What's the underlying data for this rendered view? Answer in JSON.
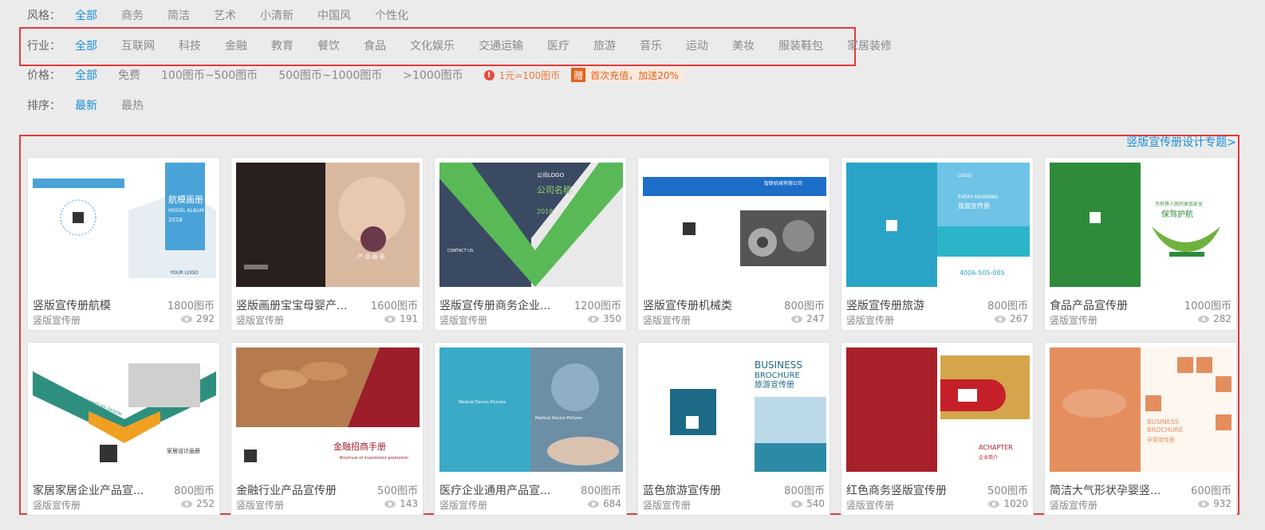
{
  "filters": {
    "style": {
      "label": "风格：",
      "options": [
        "全部",
        "商务",
        "简洁",
        "艺术",
        "小清新",
        "中国风",
        "个性化"
      ],
      "active": 0
    },
    "industry": {
      "label": "行业：",
      "options": [
        "全部",
        "互联网",
        "科技",
        "金融",
        "教育",
        "餐饮",
        "食品",
        "文化娱乐",
        "交通运输",
        "医疗",
        "旅游",
        "音乐",
        "运动",
        "美妆",
        "服装鞋包",
        "家居装修"
      ],
      "active": 0
    },
    "price": {
      "label": "价格：",
      "options": [
        "全部",
        "免费",
        "100图币~500图币",
        "500图币~1000图币",
        ">1000图币"
      ],
      "active": 0,
      "rate_note": "1元=100图币",
      "gift_icon": "赠",
      "gift_note": "首次充值，加送20%"
    },
    "sort": {
      "label": "排序：",
      "options": [
        "最新",
        "最热"
      ],
      "active": 0
    }
  },
  "topic_link": "竖版宣传册设计专题>",
  "colors": {
    "accent": "#1a8fd8",
    "highlight": "#e33a3a",
    "warning": "#f07a3a"
  },
  "cards": [
    {
      "title": "竖版宣传册航模",
      "price": "1800图币",
      "category": "竖版宣传册",
      "views": "292",
      "thumb": {
        "t1": "航模画册",
        "t2": "MODEL ALBUM",
        "t3": "2018",
        "t4": "YOUR LOGO"
      }
    },
    {
      "title": "竖版画册宝宝母婴产...",
      "price": "1600图币",
      "category": "竖版宣传册",
      "views": "191",
      "thumb": {
        "t1": "产 品 画 册"
      }
    },
    {
      "title": "竖版宣传册商务企业...",
      "price": "1200图币",
      "category": "竖版宣传册",
      "views": "350",
      "thumb": {
        "t1": "公司LOGO",
        "t2": "公司名称",
        "t3": "2018",
        "t4": "CONTACT US"
      }
    },
    {
      "title": "竖版宣传册机械类",
      "price": "800图币",
      "category": "竖版宣传册",
      "views": "247",
      "thumb": {
        "t1": "智联机械有限公司"
      }
    },
    {
      "title": "竖版宣传册旅游",
      "price": "800图币",
      "category": "竖版宣传册",
      "views": "267",
      "thumb": {
        "t1": "LOGO",
        "t2": "EVERY MORNING",
        "t3": "旅游宣传册",
        "t4": "4006-505-005"
      }
    },
    {
      "title": "食品产品宣传册",
      "price": "1000图币",
      "category": "竖版宣传册",
      "views": "282",
      "thumb": {
        "t1": "保驾护航",
        "t2": "为世界人民的食品安全"
      }
    },
    {
      "title": "家居家居企业产品宣...",
      "price": "800图币",
      "category": "竖版宣传册",
      "views": "252",
      "thumb": {
        "t1": "PICTURE ALBUM OF FURNITURE DESIGN",
        "t2": "家居设计画册"
      }
    },
    {
      "title": "金融行业产品宣传册",
      "price": "500图币",
      "category": "竖版宣传册",
      "views": "143",
      "thumb": {
        "t1": "金融招商手册",
        "t2": "Brochure of investment promotion"
      }
    },
    {
      "title": "医疗企业通用产品宣...",
      "price": "800图币",
      "category": "竖版宣传册",
      "views": "684",
      "thumb": {
        "t1": "Medical Device Pictures",
        "t2": "Medical Device Pictures"
      }
    },
    {
      "title": "蓝色旅游宣传册",
      "price": "800图币",
      "category": "竖版宣传册",
      "views": "540",
      "thumb": {
        "t1": "BUSINESS",
        "t2": "BROCHURE",
        "t3": "旅游宣传册"
      }
    },
    {
      "title": "红色商务竖版宣传册",
      "price": "500图币",
      "category": "竖版宣传册",
      "views": "1020",
      "thumb": {
        "t1": "ACHAPTER",
        "t2": "企业简介"
      }
    },
    {
      "title": "简洁大气形状孕婴竖...",
      "price": "600图币",
      "category": "竖版宣传册",
      "views": "932",
      "thumb": {
        "t1": "BUSINESS",
        "t2": "BROCHURE",
        "t3": "孕婴宣传册"
      }
    }
  ]
}
